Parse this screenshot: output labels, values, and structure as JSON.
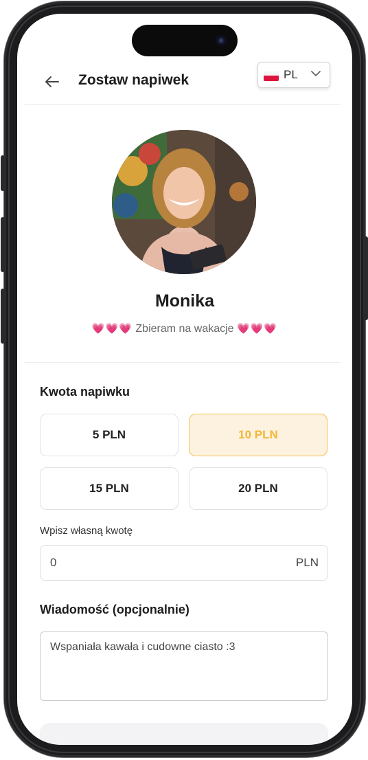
{
  "header": {
    "title": "Zostaw napiwek",
    "language": {
      "code": "PL",
      "flag": "poland-flag-icon"
    }
  },
  "profile": {
    "name": "Monika",
    "bio_text": "Zbieram na wakacje",
    "bio_hearts_left": "💗💗💗",
    "bio_hearts_right": "💗💗💗",
    "heart_color": "#e8336a"
  },
  "tip": {
    "section_title": "Kwota napiwku",
    "amounts": [
      {
        "label": "5 PLN",
        "selected": false
      },
      {
        "label": "10 PLN",
        "selected": true
      },
      {
        "label": "15 PLN",
        "selected": false
      },
      {
        "label": "20 PLN",
        "selected": false
      }
    ],
    "selected_color": "#f3b635",
    "custom_label": "Wpisz własną kwotę",
    "custom_value": "0",
    "custom_unit": "PLN"
  },
  "message": {
    "section_title": "Wiadomość (opcjonalnie)",
    "value": "Wspaniała kawała i cudowne ciasto :3"
  }
}
